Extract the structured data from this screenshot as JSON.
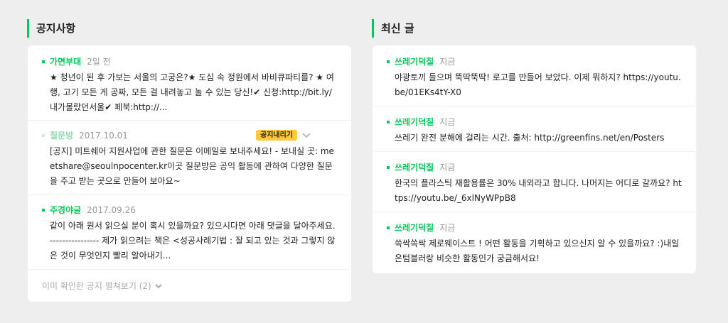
{
  "notices": {
    "title": "공지사항",
    "items": [
      {
        "author": "가면부대",
        "time": "2일 전",
        "text": "★ 청년이 된 후 가보는 서울의 고궁은?★ 도심 속 정원에서 바비큐파티를? ★ 여행, 고기 모든 게 공짜, 모든 걸 내려놓고 놀 수 있는 당신!✔ 신청:http://bit.ly/내가몰랐던서울✔ 페북:http://..."
      },
      {
        "author": "질문방",
        "time": "2017.10.01",
        "badge": "공지내리기",
        "text": "[공지] 미트쉐어 지원사업에 관한 질문은 이메일로 보내주세요! - 보내실 곳: meetshare@seoulnpocenter.kr이곳 질문방은 공익 활동에 관하여 다양한 질문을 주고 받는 곳으로 만들어 보아요~"
      },
      {
        "author": "주경야글",
        "time": "2017.09.26",
        "text": "같이 아래 원서 읽으실 분이 혹시 있을까요? 있으시다면 아래 댓글을 달아주세요. ---------------- 제가 읽으려는 책은 <성공사례기법 : 잘 되고 있는 것과 그렇지 않은 것이 무엇인지 빨리 알아내기..."
      }
    ],
    "more_label": "이미 확인한 공지 펼쳐보기 (2)"
  },
  "recent": {
    "title": "최신 글",
    "items": [
      {
        "author": "쓰레기덕질",
        "time": "지금",
        "text": "야광토끼 들으며 뚝딱뚝딱! 로고를 만들어 보았다. 이제 뭐하지? https://youtu.be/01EKs4tY-X0"
      },
      {
        "author": "쓰레기덕질",
        "time": "지금",
        "text": "쓰레기 완전 분해에 걸리는 시간. 출처: http://greenfins.net/en/Posters"
      },
      {
        "author": "쓰레기덕질",
        "time": "지금",
        "text": "한국의 플라스틱 재활용률은 30% 내외라고 합니다. 나머지는 어디로 갈까요? https://youtu.be/_6xlNyWPpB8"
      },
      {
        "author": "쓰레기덕질",
        "time": "지금",
        "text": "쓱싹쓱싹 제로웨이스트 ! 어떤 활동을 기획하고 있으신지 알 수 있을까요? :)내일은텀블러랑 비슷한 활동인가 궁금해서요!"
      }
    ]
  },
  "colors": {
    "accent": "#03c75a",
    "badge": "#ffc93a",
    "background": "#eeeeee"
  }
}
